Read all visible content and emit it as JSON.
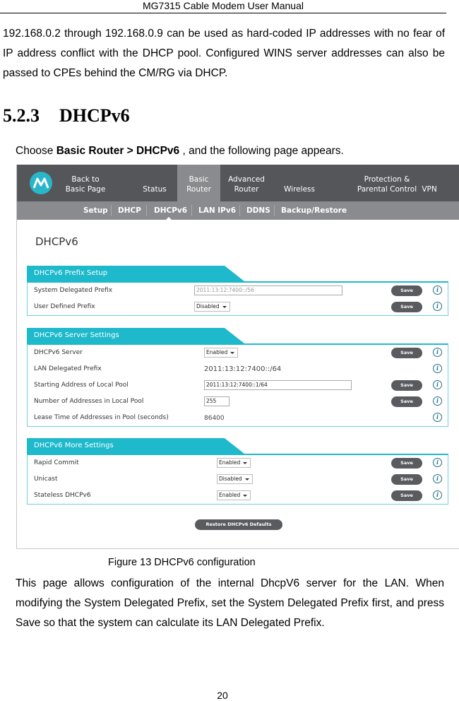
{
  "doc": {
    "header": "MG7315 Cable Modem User Manual",
    "intro_paragraph": "192.168.0.2 through 192.168.0.9 can be used as hard-coded IP addresses with no fear of IP address conflict with the DHCP pool. Configured WINS server addresses can also be passed to CPEs behind the CM/RG via DHCP.",
    "section_number": "5.2.3",
    "section_title": "DHCPv6",
    "choose_prefix": "Choose ",
    "choose_bold": "Basic Router > DHCPv6",
    "choose_suffix": " , and the following page appears.",
    "figure_caption": "Figure 13 DHCPv6 configuration",
    "body_paragraph": "This page allows configuration of the internal DhcpV6 server for the LAN. When modifying the System Delegated Prefix, set the System Delegated Prefix first, and press Save so that the system can calculate its LAN Delegated Prefix.",
    "page_number": "20"
  },
  "ui": {
    "logo_icon": "motorola-logo-icon",
    "colors": {
      "accent": "#1fb9cc",
      "nav_bg": "#54565a",
      "nav_active": "#898b8e",
      "button": "#595b5f"
    },
    "top_nav": [
      {
        "line1": "Back to",
        "line2": "Basic Page",
        "active": false
      },
      {
        "line1": "",
        "line2": "Status",
        "active": false
      },
      {
        "line1": "Basic",
        "line2": "Router",
        "active": true
      },
      {
        "line1": "Advanced",
        "line2": "Router",
        "active": false
      },
      {
        "line1": "",
        "line2": "Wireless",
        "active": false
      },
      {
        "line1": "Protection &",
        "line2": "Parental Control",
        "active": false
      },
      {
        "line1": "",
        "line2": "VPN",
        "active": false
      }
    ],
    "sub_nav": [
      "Setup",
      "DHCP",
      "DHCPv6",
      "LAN IPv6",
      "DDNS",
      "Backup/Restore"
    ],
    "sub_nav_active": "DHCPv6",
    "page_title": "DHCPv6",
    "save_label": "Save",
    "info_glyph": "i",
    "prefix_setup": {
      "title": "DHCPv6 Prefix Setup",
      "rows": [
        {
          "label": "System Delegated Prefix",
          "value": "2011:13:12:7400::/56"
        },
        {
          "label": "User Defined Prefix",
          "value": "Disabled"
        }
      ]
    },
    "server_settings": {
      "title": "DHCPv6 Server Settings",
      "rows": [
        {
          "label": "DHCPv6 Server",
          "value": "Enabled"
        },
        {
          "label": "LAN Delegated Prefix",
          "value": "2011:13:12:7400::/64"
        },
        {
          "label": "Starting Address of Local Pool",
          "value": "2011:13:12:7400::1/64"
        },
        {
          "label": "Number of Addresses in Local Pool",
          "value": "255"
        },
        {
          "label": "Lease Time of Addresses in Pool (seconds)",
          "value": "86400"
        }
      ]
    },
    "more_settings": {
      "title": "DHCPv6 More Settings",
      "rows": [
        {
          "label": "Rapid Commit",
          "value": "Enabled"
        },
        {
          "label": "Unicast",
          "value": "Disabled"
        },
        {
          "label": "Stateless DHCPv6",
          "value": "Enabled"
        }
      ]
    },
    "restore_button": "Restore DHCPv6 Defaults"
  }
}
